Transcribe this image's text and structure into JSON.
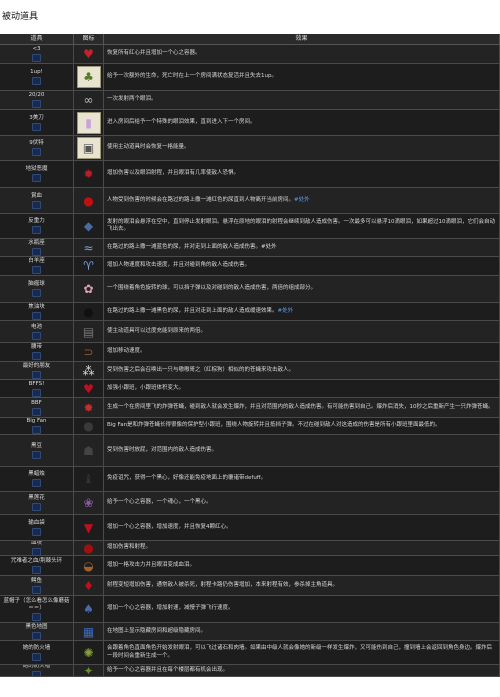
{
  "page_title": "被动道具",
  "header": {
    "col_name": "道具",
    "col_icon": "图标",
    "col_effect": "效果"
  },
  "rows": [
    {
      "name": "<3",
      "id": "",
      "icon_name": "heart-icon",
      "glyph": "♥",
      "color": "#c8202a",
      "light": false,
      "effect": "恢复所有红心并且增加一个心之容器。",
      "tag": "",
      "h": 19
    },
    {
      "name": "1up!",
      "id": "",
      "icon_name": "mushroom-icon",
      "glyph": "♣",
      "color": "#5a7a2a",
      "light": true,
      "effect": "给予一次额外的生命，死亡时在上一个房间满状态复活并且失去1up。",
      "tag": "",
      "h": 27
    },
    {
      "name": "20/20",
      "id": "",
      "icon_name": "glasses-icon",
      "glyph": "∞",
      "color": "#bbbbbb",
      "light": false,
      "effect": "一次发射两个眼泪。",
      "tag": "",
      "h": 19
    },
    {
      "name": "3美刀",
      "id": "",
      "icon_name": "card-icon",
      "glyph": "▮",
      "color": "#c9a0e0",
      "light": true,
      "effect": "进入房间后给予一个特殊的眼泪效果，直到进入下一个房间。",
      "tag": "",
      "h": 26
    },
    {
      "name": "9伏特",
      "id": "",
      "icon_name": "battery-icon",
      "glyph": "▣",
      "color": "#555555",
      "light": true,
      "effect": "使用主动道具时会恢复一格能量。",
      "tag": "",
      "h": 25
    },
    {
      "name": "地狱恶魔",
      "id": "",
      "icon_name": "demon-face-icon",
      "glyph": "✹",
      "color": "#b8202a",
      "light": false,
      "effect": "增加伤害以及眼泪射程，并且眼泪有几率使敌人恐惧。",
      "tag": "",
      "h": 27
    },
    {
      "name": "賞血",
      "id": "",
      "icon_name": "blood-drop-icon",
      "glyph": "●",
      "color": "#c01010",
      "light": false,
      "effect": "人物受到伤害的时候会在路过的路上撒一滩红色的尿直到人物离开当前房间。",
      "tag": "#处外",
      "h": 26
    },
    {
      "name": "反重力",
      "id": "",
      "icon_name": "anti-gravity-icon",
      "glyph": "◆",
      "color": "#4a6aa0",
      "light": false,
      "effect": "发射的眼泪会悬浮在空中，直到停止发射眼泪。悬浮在原地的眼泪的射程会继续到敌人造成伤害。一次最多可以悬浮10滴眼泪，如果超过10滴眼泪，它们会自动飞出去。",
      "tag": "",
      "h": 25
    },
    {
      "name": "水瓶座",
      "id": "",
      "icon_name": "aquarius-icon",
      "glyph": "≈",
      "color": "#7aa0d8",
      "light": false,
      "effect": "在路过的路上撒一滩蓝色的尿，并对走到上面的敌人造成伤害。#处外",
      "tag": "",
      "h": 18
    },
    {
      "name": "白羊座",
      "id": "",
      "icon_name": "aries-icon",
      "glyph": "♈",
      "color": "#7aa0d8",
      "light": false,
      "effect": "增加人物速度和攻击速度，并且对碰到角的敌人造成伤害。",
      "tag": "",
      "h": 19
    },
    {
      "name": "脑瘤球",
      "id": "",
      "icon_name": "brain-icon",
      "glyph": "✿",
      "color": "#e0a0b0",
      "light": false,
      "effect": "一个围绕着角色旋转的球，可以挡子弹以及对碰到的敌人造成伤害，两倍的组成部分。",
      "tag": "",
      "h": 27
    },
    {
      "name": "焦油块",
      "id": "",
      "icon_name": "tar-ball-icon",
      "glyph": "●",
      "color": "#111111",
      "light": false,
      "effect": "在路过的路上撒一滩黑色的尿，并且对走到上面的敌人造成缓速效果。",
      "tag": "#处外",
      "h": 18
    },
    {
      "name": "电池",
      "id": "",
      "icon_name": "battery-pack-icon",
      "glyph": "▤",
      "color": "#777777",
      "light": false,
      "effect": "使主动道具可以过度充能到原来的两倍。",
      "tag": "",
      "h": 22
    },
    {
      "name": "腰带",
      "id": "",
      "icon_name": "belt-icon",
      "glyph": "⊃",
      "color": "#8a5a3a",
      "light": false,
      "effect": "增加移动速度。",
      "tag": "",
      "h": 19
    },
    {
      "name": "最好的朋友",
      "id": "",
      "icon_name": "bomb-friend-icon",
      "glyph": "⁂",
      "color": "#dddddd",
      "light": false,
      "effect": "受到伤害之后会召唤出一只与嗷嗷哥之（红棕狗）相似的的苍蝇来攻击敌人。",
      "tag": "",
      "h": 18
    },
    {
      "name": "BFFS!",
      "id": "",
      "icon_name": "heart-bffs-icon",
      "glyph": "♥",
      "color": "#c01020",
      "light": false,
      "effect": "加强小跟班，小跟班体积变大。",
      "tag": "",
      "h": 18
    },
    {
      "name": "BBF",
      "id": "",
      "icon_name": "fly-bomb-icon",
      "glyph": "✹",
      "color": "#c03030",
      "light": false,
      "effect": "生成一个在房间里飞的炸弹苍蝇，碰到敌人就会发生爆炸，并且对范围内的敌人造成伤害。有可能伤害到自己。爆炸后消失，10秒之后重新产生一只炸弹苍蝇。",
      "tag": "",
      "h": 20
    },
    {
      "name": "Big Fan",
      "id": "",
      "icon_name": "big-fan-icon",
      "glyph": "●",
      "color": "#3a3a3a",
      "light": false,
      "effect": "Big Fan是和炸弹苍蝇长得很像的保护型小跟班，围绕人物旋转并且抵挡子弹。不过在碰到敌人对这造成的伤害是所有小跟班里面最低的。",
      "tag": "",
      "h": 17
    },
    {
      "name": "黑豆",
      "id": "",
      "icon_name": "black-bean-icon",
      "glyph": "☗",
      "color": "#444444",
      "light": false,
      "effect": "受到伤害时放屁，对范围内的敌人造成伤害。",
      "tag": "",
      "h": 32
    },
    {
      "name": "黑蜡烛",
      "id": "",
      "icon_name": "black-candle-icon",
      "glyph": "♝",
      "color": "#333333",
      "light": false,
      "effect": "免疫诅咒，获得一个黑心，好像还能免疫地面上的覆诸带defuff。",
      "tag": "",
      "h": 25
    },
    {
      "name": "黑莲花",
      "id": "",
      "icon_name": "black-lotus-icon",
      "glyph": "❀",
      "color": "#8a5aa0",
      "light": false,
      "effect": "给予一个心之容器，一个魂心，一个黑心。",
      "tag": "",
      "h": 23
    },
    {
      "name": "输血袋",
      "id": "",
      "icon_name": "blood-bag-icon",
      "glyph": "▼",
      "color": "#c01020",
      "light": false,
      "effect": "增加一个心之容器，增加速度，并且恢复4颗红心。",
      "tag": "",
      "h": 26
    },
    {
      "name": "血块",
      "id": "",
      "icon_name": "blood-clot-icon",
      "glyph": "●",
      "color": "#a01010",
      "light": false,
      "effect": "增加伤害和射程。",
      "tag": "",
      "h": 15
    },
    {
      "name": "咒难者之血/荆棘头环",
      "id": "",
      "icon_name": "crown-of-thorns-icon",
      "glyph": "◒",
      "color": "#a06030",
      "light": false,
      "effect": "增加一格攻击力并且眼泪变成血泪。",
      "tag": "",
      "h": 20
    },
    {
      "name": "鳄鱼",
      "id": "",
      "icon_name": "blood-tear-icon",
      "glyph": "♦",
      "color": "#c01020",
      "light": false,
      "effect": "射程变短增加伤害，通常敌人被杀死，射程卡路仍伤害增加，本来射程有效，参杀掉主角道具。",
      "tag": "",
      "h": 20
    },
    {
      "name": "蓝帽子（怎么看怎么像蘑菇＝＝）",
      "id": "",
      "icon_name": "blue-cap-icon",
      "glyph": "♠",
      "color": "#4a6ab0",
      "light": false,
      "effect": "增加一个心之容器，增加射速，减慢子弹飞行速度。",
      "tag": "",
      "h": 27
    },
    {
      "name": "黑色地图",
      "id": "",
      "icon_name": "blue-map-icon",
      "glyph": "▦",
      "color": "#3a6ac0",
      "light": false,
      "effect": "在地图上显示隐藏房间和超级隐藏房间。",
      "tag": "",
      "h": 18
    },
    {
      "name": "她的防火墙",
      "id": "",
      "icon_name": "bobs-brain-icon",
      "glyph": "✺",
      "color": "#8aa040",
      "light": false,
      "effect": "会跟着角色直面角色开始发射眼泪，可以飞过诸石和肉墙。如果由中级人就会像她的新级一样发生爆炸，又可能伤到自己，撞到墙上会返回到角色身边。爆炸后一段时间会重新生成一个。",
      "tag": "",
      "h": 24
    },
    {
      "name": "她的防火墙",
      "id": "",
      "icon_name": "bobs-curse-icon",
      "glyph": "✦",
      "color": "#6a8a30",
      "light": false,
      "effect": "给予一个心之容器并且在每个楼层都有机会出现。",
      "tag": "",
      "h": 12
    }
  ]
}
